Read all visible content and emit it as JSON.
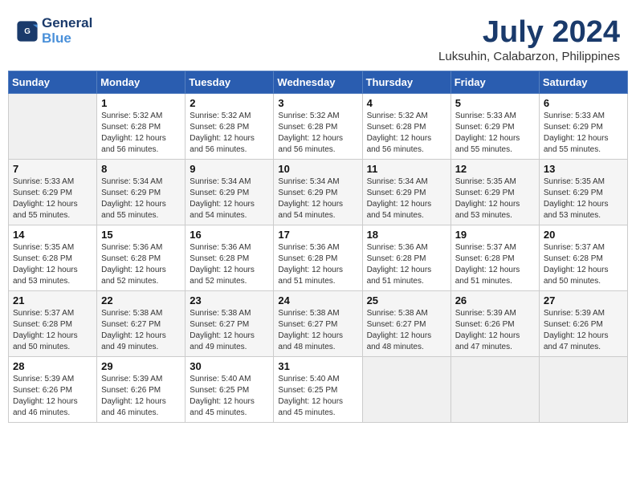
{
  "header": {
    "logo_line1": "General",
    "logo_line2": "Blue",
    "month": "July 2024",
    "location": "Luksuhin, Calabarzon, Philippines"
  },
  "weekdays": [
    "Sunday",
    "Monday",
    "Tuesday",
    "Wednesday",
    "Thursday",
    "Friday",
    "Saturday"
  ],
  "weeks": [
    [
      {
        "day": "",
        "text": ""
      },
      {
        "day": "1",
        "text": "Sunrise: 5:32 AM\nSunset: 6:28 PM\nDaylight: 12 hours\nand 56 minutes."
      },
      {
        "day": "2",
        "text": "Sunrise: 5:32 AM\nSunset: 6:28 PM\nDaylight: 12 hours\nand 56 minutes."
      },
      {
        "day": "3",
        "text": "Sunrise: 5:32 AM\nSunset: 6:28 PM\nDaylight: 12 hours\nand 56 minutes."
      },
      {
        "day": "4",
        "text": "Sunrise: 5:32 AM\nSunset: 6:28 PM\nDaylight: 12 hours\nand 56 minutes."
      },
      {
        "day": "5",
        "text": "Sunrise: 5:33 AM\nSunset: 6:29 PM\nDaylight: 12 hours\nand 55 minutes."
      },
      {
        "day": "6",
        "text": "Sunrise: 5:33 AM\nSunset: 6:29 PM\nDaylight: 12 hours\nand 55 minutes."
      }
    ],
    [
      {
        "day": "7",
        "text": "Sunrise: 5:33 AM\nSunset: 6:29 PM\nDaylight: 12 hours\nand 55 minutes."
      },
      {
        "day": "8",
        "text": "Sunrise: 5:34 AM\nSunset: 6:29 PM\nDaylight: 12 hours\nand 55 minutes."
      },
      {
        "day": "9",
        "text": "Sunrise: 5:34 AM\nSunset: 6:29 PM\nDaylight: 12 hours\nand 54 minutes."
      },
      {
        "day": "10",
        "text": "Sunrise: 5:34 AM\nSunset: 6:29 PM\nDaylight: 12 hours\nand 54 minutes."
      },
      {
        "day": "11",
        "text": "Sunrise: 5:34 AM\nSunset: 6:29 PM\nDaylight: 12 hours\nand 54 minutes."
      },
      {
        "day": "12",
        "text": "Sunrise: 5:35 AM\nSunset: 6:29 PM\nDaylight: 12 hours\nand 53 minutes."
      },
      {
        "day": "13",
        "text": "Sunrise: 5:35 AM\nSunset: 6:29 PM\nDaylight: 12 hours\nand 53 minutes."
      }
    ],
    [
      {
        "day": "14",
        "text": "Sunrise: 5:35 AM\nSunset: 6:28 PM\nDaylight: 12 hours\nand 53 minutes."
      },
      {
        "day": "15",
        "text": "Sunrise: 5:36 AM\nSunset: 6:28 PM\nDaylight: 12 hours\nand 52 minutes."
      },
      {
        "day": "16",
        "text": "Sunrise: 5:36 AM\nSunset: 6:28 PM\nDaylight: 12 hours\nand 52 minutes."
      },
      {
        "day": "17",
        "text": "Sunrise: 5:36 AM\nSunset: 6:28 PM\nDaylight: 12 hours\nand 51 minutes."
      },
      {
        "day": "18",
        "text": "Sunrise: 5:36 AM\nSunset: 6:28 PM\nDaylight: 12 hours\nand 51 minutes."
      },
      {
        "day": "19",
        "text": "Sunrise: 5:37 AM\nSunset: 6:28 PM\nDaylight: 12 hours\nand 51 minutes."
      },
      {
        "day": "20",
        "text": "Sunrise: 5:37 AM\nSunset: 6:28 PM\nDaylight: 12 hours\nand 50 minutes."
      }
    ],
    [
      {
        "day": "21",
        "text": "Sunrise: 5:37 AM\nSunset: 6:28 PM\nDaylight: 12 hours\nand 50 minutes."
      },
      {
        "day": "22",
        "text": "Sunrise: 5:38 AM\nSunset: 6:27 PM\nDaylight: 12 hours\nand 49 minutes."
      },
      {
        "day": "23",
        "text": "Sunrise: 5:38 AM\nSunset: 6:27 PM\nDaylight: 12 hours\nand 49 minutes."
      },
      {
        "day": "24",
        "text": "Sunrise: 5:38 AM\nSunset: 6:27 PM\nDaylight: 12 hours\nand 48 minutes."
      },
      {
        "day": "25",
        "text": "Sunrise: 5:38 AM\nSunset: 6:27 PM\nDaylight: 12 hours\nand 48 minutes."
      },
      {
        "day": "26",
        "text": "Sunrise: 5:39 AM\nSunset: 6:26 PM\nDaylight: 12 hours\nand 47 minutes."
      },
      {
        "day": "27",
        "text": "Sunrise: 5:39 AM\nSunset: 6:26 PM\nDaylight: 12 hours\nand 47 minutes."
      }
    ],
    [
      {
        "day": "28",
        "text": "Sunrise: 5:39 AM\nSunset: 6:26 PM\nDaylight: 12 hours\nand 46 minutes."
      },
      {
        "day": "29",
        "text": "Sunrise: 5:39 AM\nSunset: 6:26 PM\nDaylight: 12 hours\nand 46 minutes."
      },
      {
        "day": "30",
        "text": "Sunrise: 5:40 AM\nSunset: 6:25 PM\nDaylight: 12 hours\nand 45 minutes."
      },
      {
        "day": "31",
        "text": "Sunrise: 5:40 AM\nSunset: 6:25 PM\nDaylight: 12 hours\nand 45 minutes."
      },
      {
        "day": "",
        "text": ""
      },
      {
        "day": "",
        "text": ""
      },
      {
        "day": "",
        "text": ""
      }
    ]
  ]
}
